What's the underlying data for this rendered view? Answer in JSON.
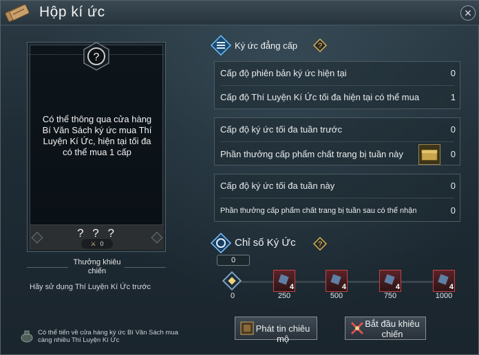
{
  "window": {
    "title": "Hộp kí ức",
    "close_icon": "close-icon"
  },
  "card": {
    "badge_icon": "question-mark-icon",
    "description": "Có thể thông qua cửa hàng Bí Văn Sách ký ức mua Thí Luyện Kí Ức, hiện tại tối đa có thể mua 1 cấp",
    "name": "? ? ?",
    "count": "0"
  },
  "left": {
    "reward_label": "Thưởng khiêu chiến",
    "hint": "Hãy sử dụng Thí Luyện Kí Ức trước",
    "bottom_note": "Có thể tiến về cửa hàng ký ức Bí Văn Sách mua càng nhiều Thí Luyện Kí Ức"
  },
  "level_section": {
    "title": "Ký ức đẳng cấp",
    "box1": [
      {
        "label": "Cấp độ phiên bản ký ức hiện tại",
        "value": "0"
      },
      {
        "label": "Cấp độ Thí Luyện Kí Ức tối đa hiện tại có thể mua",
        "value": "1"
      }
    ],
    "box2": [
      {
        "label": "Cấp độ ký ức tối đa tuần trước",
        "value": "0"
      },
      {
        "label": "Phần thưởng cấp phẩm chất trang bị tuần này",
        "value": "0"
      }
    ],
    "box3": [
      {
        "label": "Cấp độ ký ức tối đa tuần này",
        "value": "0"
      },
      {
        "label": "Phần thưởng cấp phẩm chất trang bị tuần sau có thể nhận",
        "value": "0"
      }
    ]
  },
  "index_section": {
    "title": "Chỉ số Ký Ức",
    "current_value": "0",
    "start_tick": "0",
    "milestones": [
      {
        "tick": "250",
        "count": "4"
      },
      {
        "tick": "500",
        "count": "4"
      },
      {
        "tick": "750",
        "count": "4"
      },
      {
        "tick": "1000",
        "count": "4"
      }
    ]
  },
  "buttons": {
    "broadcast": "Phát tin chiêu mộ",
    "start": "Bắt đầu khiêu chiến"
  },
  "colors": {
    "accent_blue": "#4aa6e8",
    "milestone_red": "#c7434a",
    "gold": "#d8b25a"
  }
}
